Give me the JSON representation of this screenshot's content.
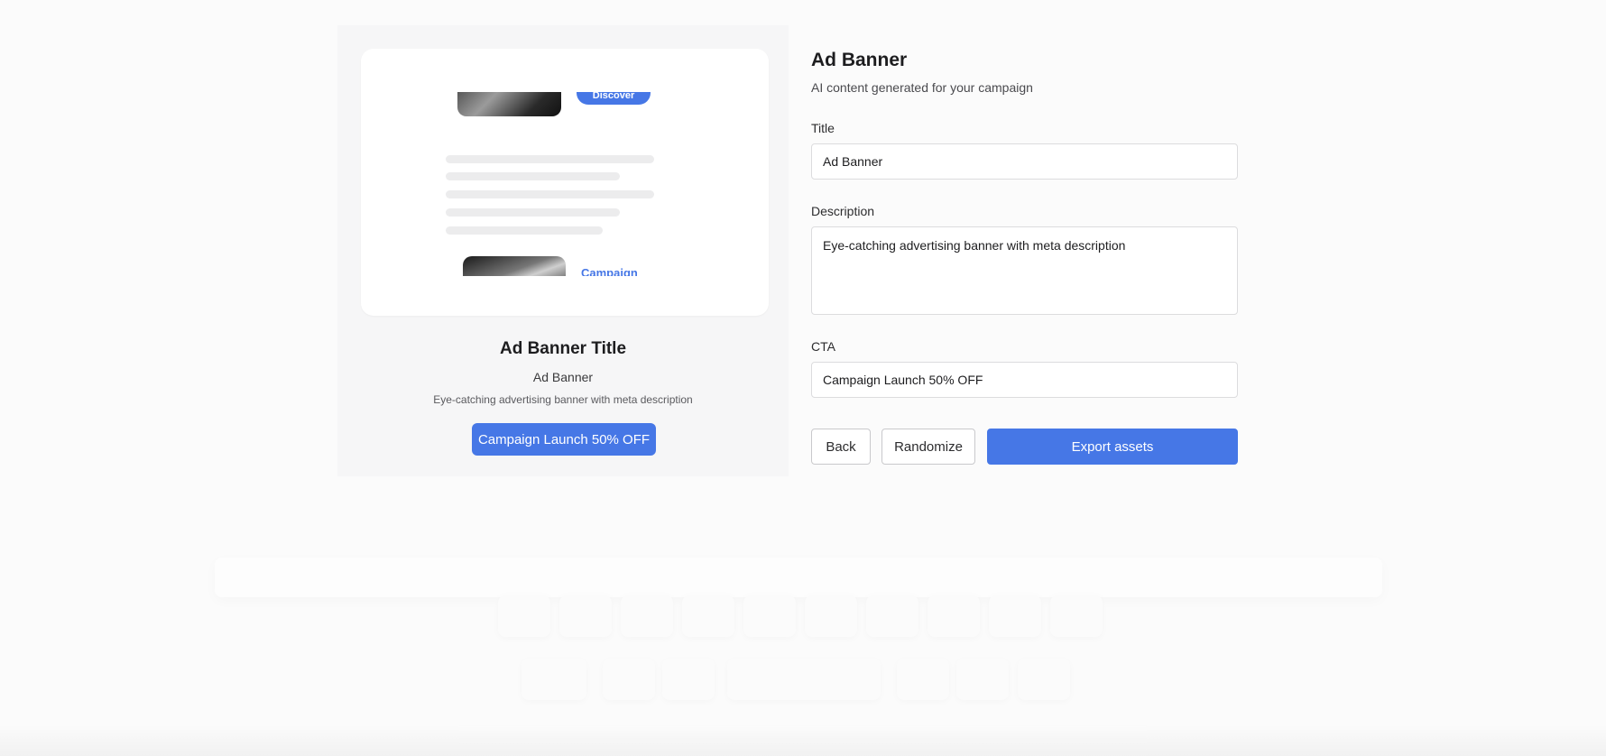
{
  "preview": {
    "mock_button_label": "Discover",
    "mock_link_label": "Campaign",
    "ad_title": "Ad Banner Title",
    "ad_name": "Ad Banner",
    "ad_description": "Eye-catching advertising banner with meta description",
    "ad_cta": "Campaign Launch 50% OFF"
  },
  "form": {
    "heading": "Ad Banner",
    "subtitle": "AI content generated for your campaign",
    "title_label": "Title",
    "title_value": "Ad Banner",
    "description_label": "Description",
    "description_value": "Eye-catching advertising banner with meta description",
    "cta_label": "CTA",
    "cta_value": "Campaign Launch 50% OFF"
  },
  "actions": {
    "back": "Back",
    "randomize": "Randomize",
    "export": "Export assets"
  },
  "colors": {
    "accent": "#4677e6",
    "background": "#fbfbfb",
    "panel": "#f6f6f7"
  }
}
